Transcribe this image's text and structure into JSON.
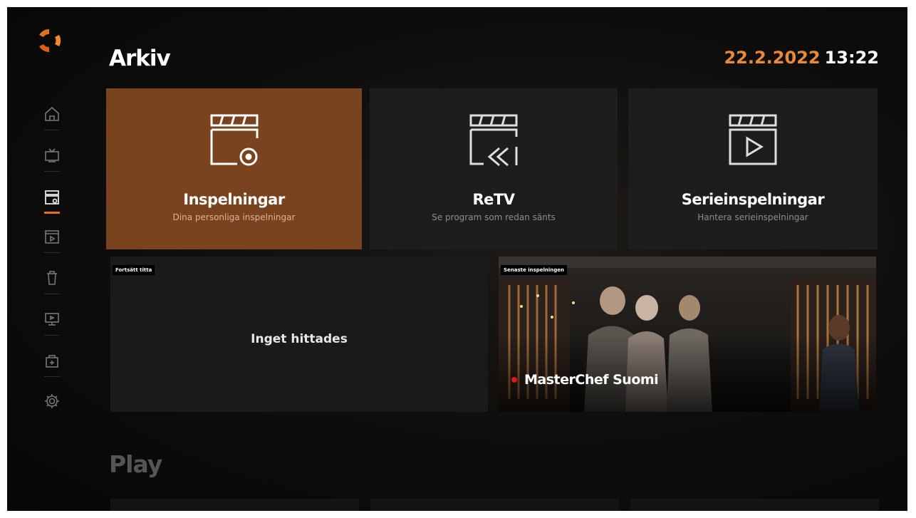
{
  "header": {
    "title": "Arkiv",
    "date": "22.2.2022",
    "time": "13:22"
  },
  "sidebar": {
    "logo_icon": "brand-logo-icon",
    "active_color": "#e0701e",
    "items": [
      {
        "name": "home",
        "icon": "home-icon"
      },
      {
        "name": "tv-guide",
        "icon": "tv-icon"
      },
      {
        "name": "archive",
        "icon": "archive-icon",
        "active": true
      },
      {
        "name": "calendar",
        "icon": "calendar-icon"
      },
      {
        "name": "trash",
        "icon": "trash-icon"
      },
      {
        "name": "screen",
        "icon": "monitor-icon"
      },
      {
        "name": "store",
        "icon": "store-icon"
      },
      {
        "name": "settings",
        "icon": "gear-icon"
      }
    ]
  },
  "tiles": [
    {
      "title": "Inspelningar",
      "subtitle": "Dina personliga inspelningar",
      "icon": "recordings-icon",
      "active": true
    },
    {
      "title": "ReTV",
      "subtitle": "Se program som redan sänts",
      "icon": "retv-icon"
    },
    {
      "title": "Serieinspelningar",
      "subtitle": "Hantera serieinspelningar",
      "icon": "series-recording-icon"
    }
  ],
  "cards": {
    "continue": {
      "tag": "Fortsätt titta",
      "empty_text": "Inget hittades"
    },
    "latest": {
      "tag": "Senaste inspelningen",
      "title": "MasterChef Suomi",
      "indicator_color": "#e01818"
    }
  },
  "section": {
    "title": "Play"
  },
  "colors": {
    "accent": "#e0701e",
    "date": "#e88a3c",
    "active_tile": "#7a431f"
  }
}
